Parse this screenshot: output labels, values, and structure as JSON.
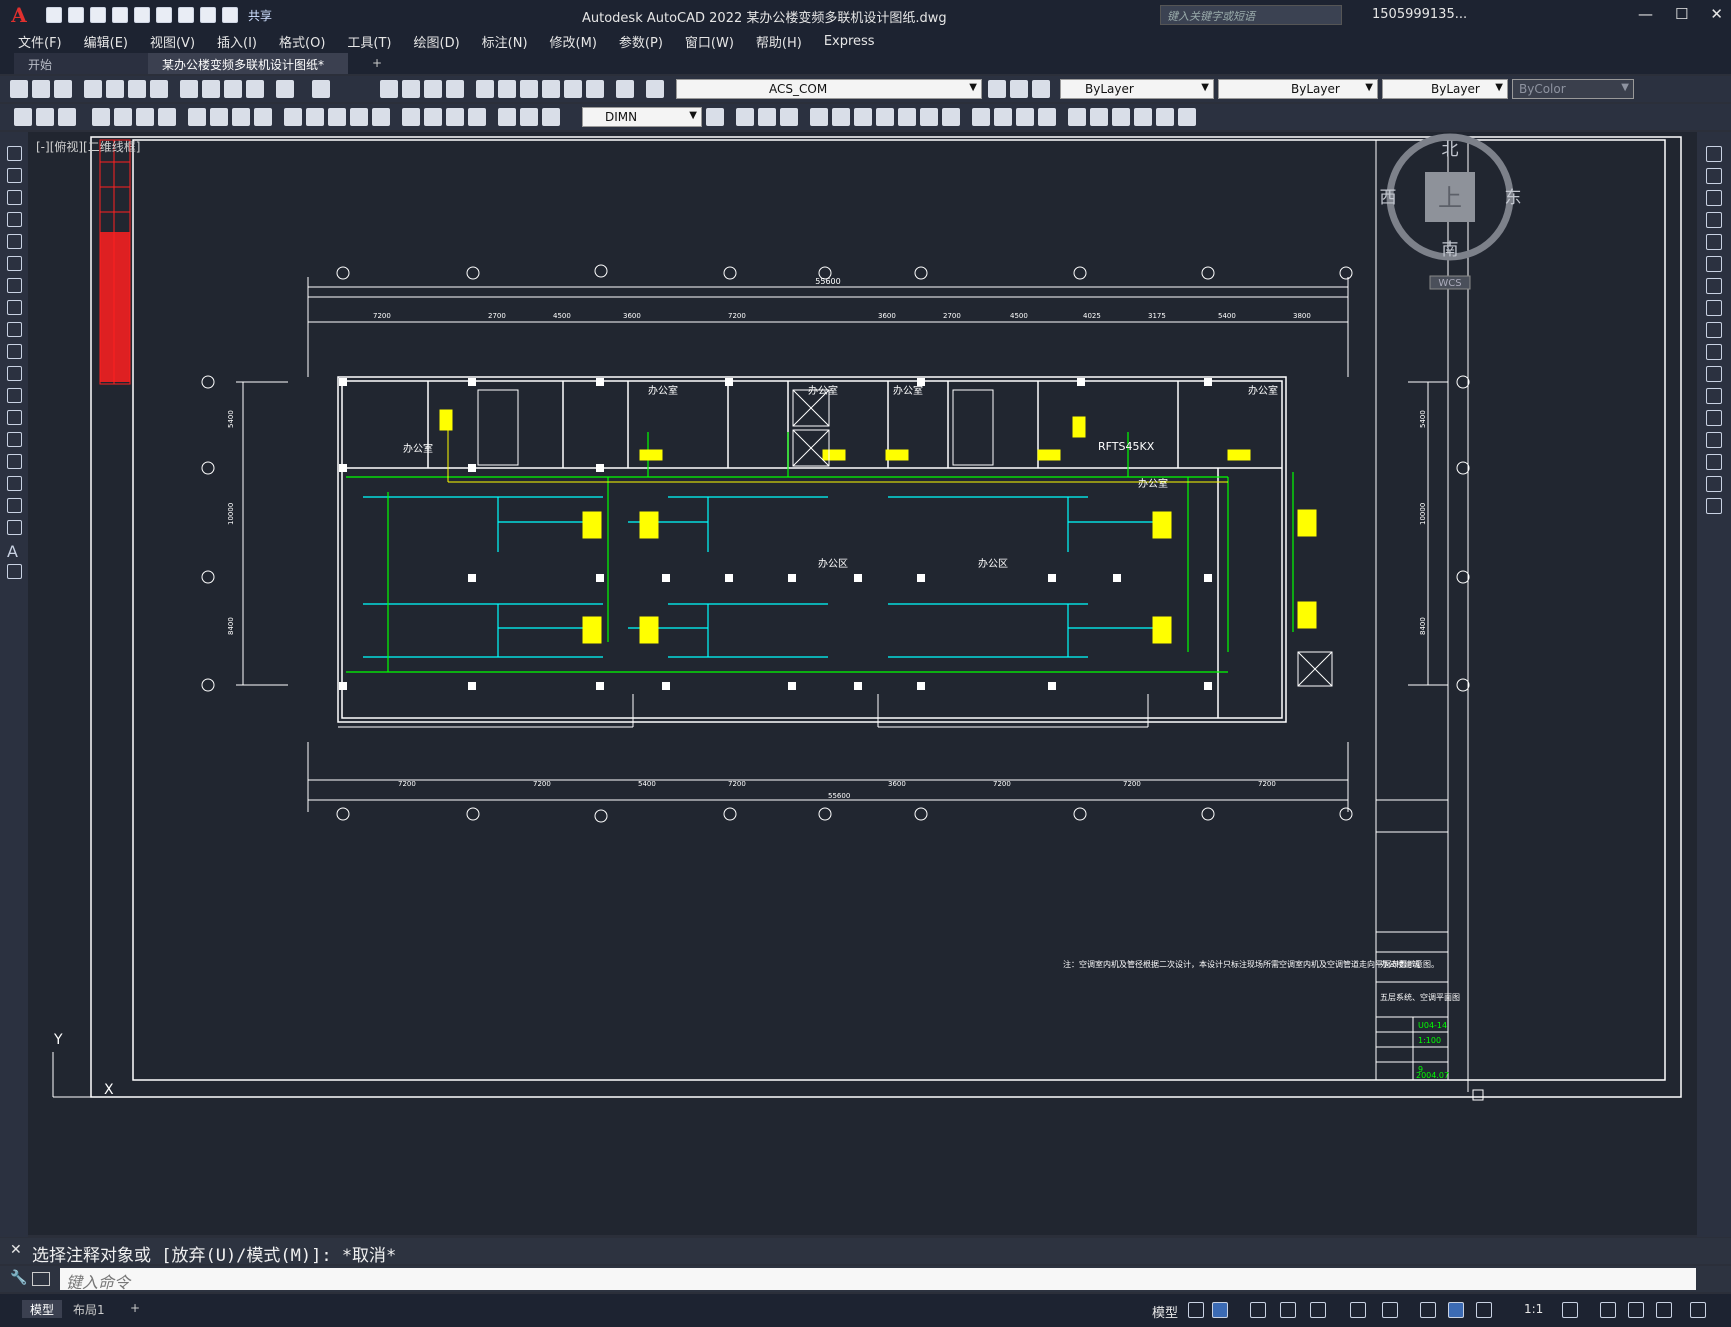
{
  "app": {
    "title": "Autodesk AutoCAD 2022    某办公楼变频多联机设计图纸.dwg",
    "search_placeholder": "键入关键字或短语",
    "user": "1505999135...",
    "share": "共享",
    "logo": "A"
  },
  "menu": [
    "文件(F)",
    "编辑(E)",
    "视图(V)",
    "插入(I)",
    "格式(O)",
    "工具(T)",
    "绘图(D)",
    "标注(N)",
    "修改(M)",
    "参数(P)",
    "窗口(W)",
    "帮助(H)",
    "Express"
  ],
  "tabs": {
    "start": "开始",
    "doc": "某办公楼变频多联机设计图纸*",
    "close": "✕",
    "plus": "+"
  },
  "toolbar": {
    "layer": "ACS_COM",
    "color": "ByLayer",
    "linetype": "ByLayer",
    "lineweight": "ByLayer",
    "plotstyle": "ByColor",
    "dimstyle": "DIMN"
  },
  "viewport_label": "[-][俯视][二维线框]",
  "compass": {
    "n": "北",
    "s": "南",
    "e": "东",
    "w": "西",
    "center": "上",
    "wcs": "WCS"
  },
  "drawing": {
    "dim_top_total": "55600",
    "dim_top": [
      "7200",
      "2700",
      "4500",
      "3600",
      "7200",
      "3600",
      "2700",
      "4500",
      "4025",
      "3175",
      "5400",
      "3800"
    ],
    "dim_bottom_total": "55600",
    "dim_bottom": [
      "7200",
      "7200",
      "5400",
      "7200",
      "3600",
      "7200",
      "7200",
      "7200"
    ],
    "dim_left": [
      "5400",
      "10000",
      "8400"
    ],
    "dim_right": [
      "5400",
      "10000",
      "8400"
    ],
    "rooms": [
      "办公室",
      "办公室",
      "办公室",
      "办公室",
      "办公室",
      "办公室",
      "办公区",
      "办公区"
    ],
    "unit_label": "RFTS45KX",
    "note": "注：空调室内机及管径根据二次设计，本设计只标注现场所需空调室内机及空调管道走向平面布置示意图。",
    "title_block": {
      "project": "办公楼建筑",
      "drawing": "五层系统、空调平面图",
      "number": "U04-14",
      "scale": "1:100",
      "sheet": "9",
      "date": "2004.07"
    }
  },
  "ucs": {
    "y": "Y",
    "x": "X"
  },
  "cmd": {
    "history": "选择注释对象或 [放弃(U)/模式(M)]: *取消*",
    "placeholder": "键入命令"
  },
  "status": {
    "model_tab": "模型",
    "layout_tab": "布局1",
    "plus": "+",
    "model_btn": "模型",
    "scale": "1:1"
  },
  "colors": {
    "wall": "#ffffff",
    "duct": "#00ffff",
    "pipe": "#00ff00",
    "unit": "#ffff00",
    "bg": "#212630"
  }
}
